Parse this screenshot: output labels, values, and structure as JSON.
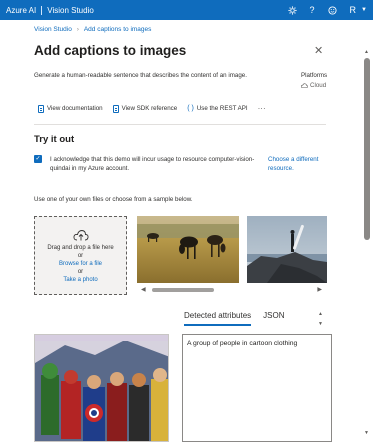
{
  "topbar": {
    "brand_left": "Azure AI",
    "brand_right": "Vision Studio",
    "settings_icon": "gear-icon",
    "help_icon": "question-icon",
    "feedback_icon": "smiley-icon",
    "account_icon": "account-icon",
    "color": "#0f6cbd"
  },
  "breadcrumb": {
    "root": "Vision Studio",
    "current": "Add captions to images"
  },
  "page": {
    "title": "Add captions to images",
    "description": "Generate a human-readable sentence that describes the content of an image.",
    "platforms_label": "Platforms",
    "platforms_value": "Cloud"
  },
  "links": {
    "documentation": "View documentation",
    "sdk": "View SDK reference",
    "rest": "Use the REST API",
    "more": "···"
  },
  "tryit": {
    "heading": "Try it out",
    "acknowledge": "I acknowledge that this demo will incur usage to resource computer-vision-quindai in my Azure account.",
    "acknowledge_checked": true,
    "choose_resource": "Choose a different resource.",
    "use_one": "Use one of your own files or choose from a sample below."
  },
  "dropzone": {
    "line1": "Drag and drop a file here",
    "or1": "or",
    "browse": "Browse for a file",
    "or2": "or",
    "photo": "Take a photo"
  },
  "samples": [
    {
      "name": "cows-in-field"
    },
    {
      "name": "surfer-on-rocks"
    }
  ],
  "results": {
    "tabs": [
      "Detected attributes",
      "JSON"
    ],
    "active_tab": "Detected attributes",
    "caption": "A group of people in cartoon clothing"
  }
}
